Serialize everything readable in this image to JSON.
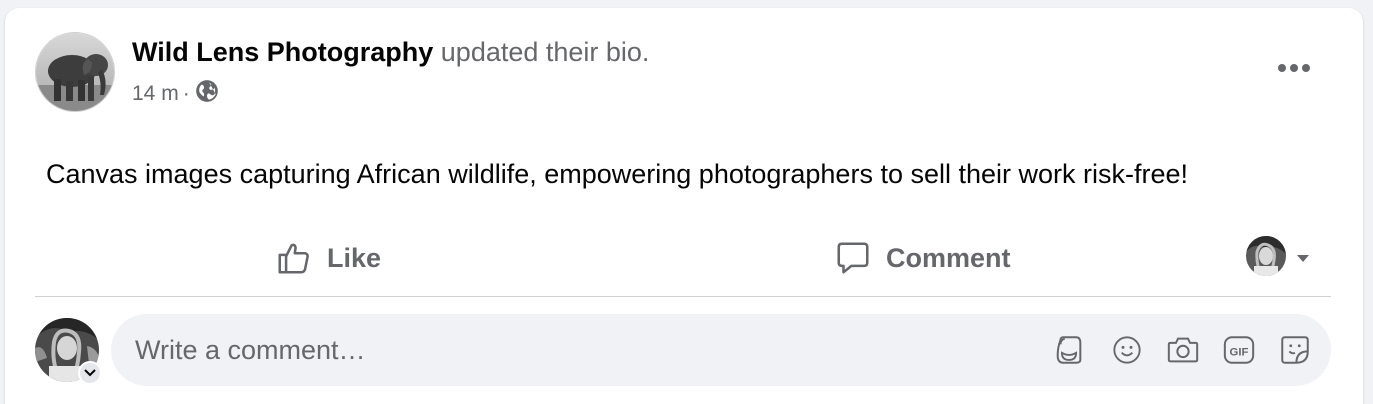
{
  "post": {
    "page_name": "Wild Lens Photography",
    "action_text": "updated their bio.",
    "timestamp": "14 m",
    "separator": "·",
    "audience_icon": "globe-icon",
    "more_icon": "more-horizontal-icon",
    "body": "Canvas images capturing African wildlife, empowering photographers to sell their work risk-free!"
  },
  "actions": {
    "like_label": "Like",
    "like_icon": "thumbs-up-icon",
    "comment_label": "Comment",
    "comment_icon": "comment-bubble-icon",
    "reaction_selector_icon": "caret-down-icon"
  },
  "composer": {
    "placeholder": "Write a comment…",
    "value": "",
    "icons": [
      "avatar-sticker-icon",
      "emoji-icon",
      "camera-icon",
      "gif-icon",
      "sticker-icon"
    ]
  },
  "colors": {
    "page_bg": "#f0f2f5",
    "card_bg": "#ffffff",
    "primary_text": "#050505",
    "secondary_text": "#65676b",
    "divider": "#ced0d4"
  }
}
